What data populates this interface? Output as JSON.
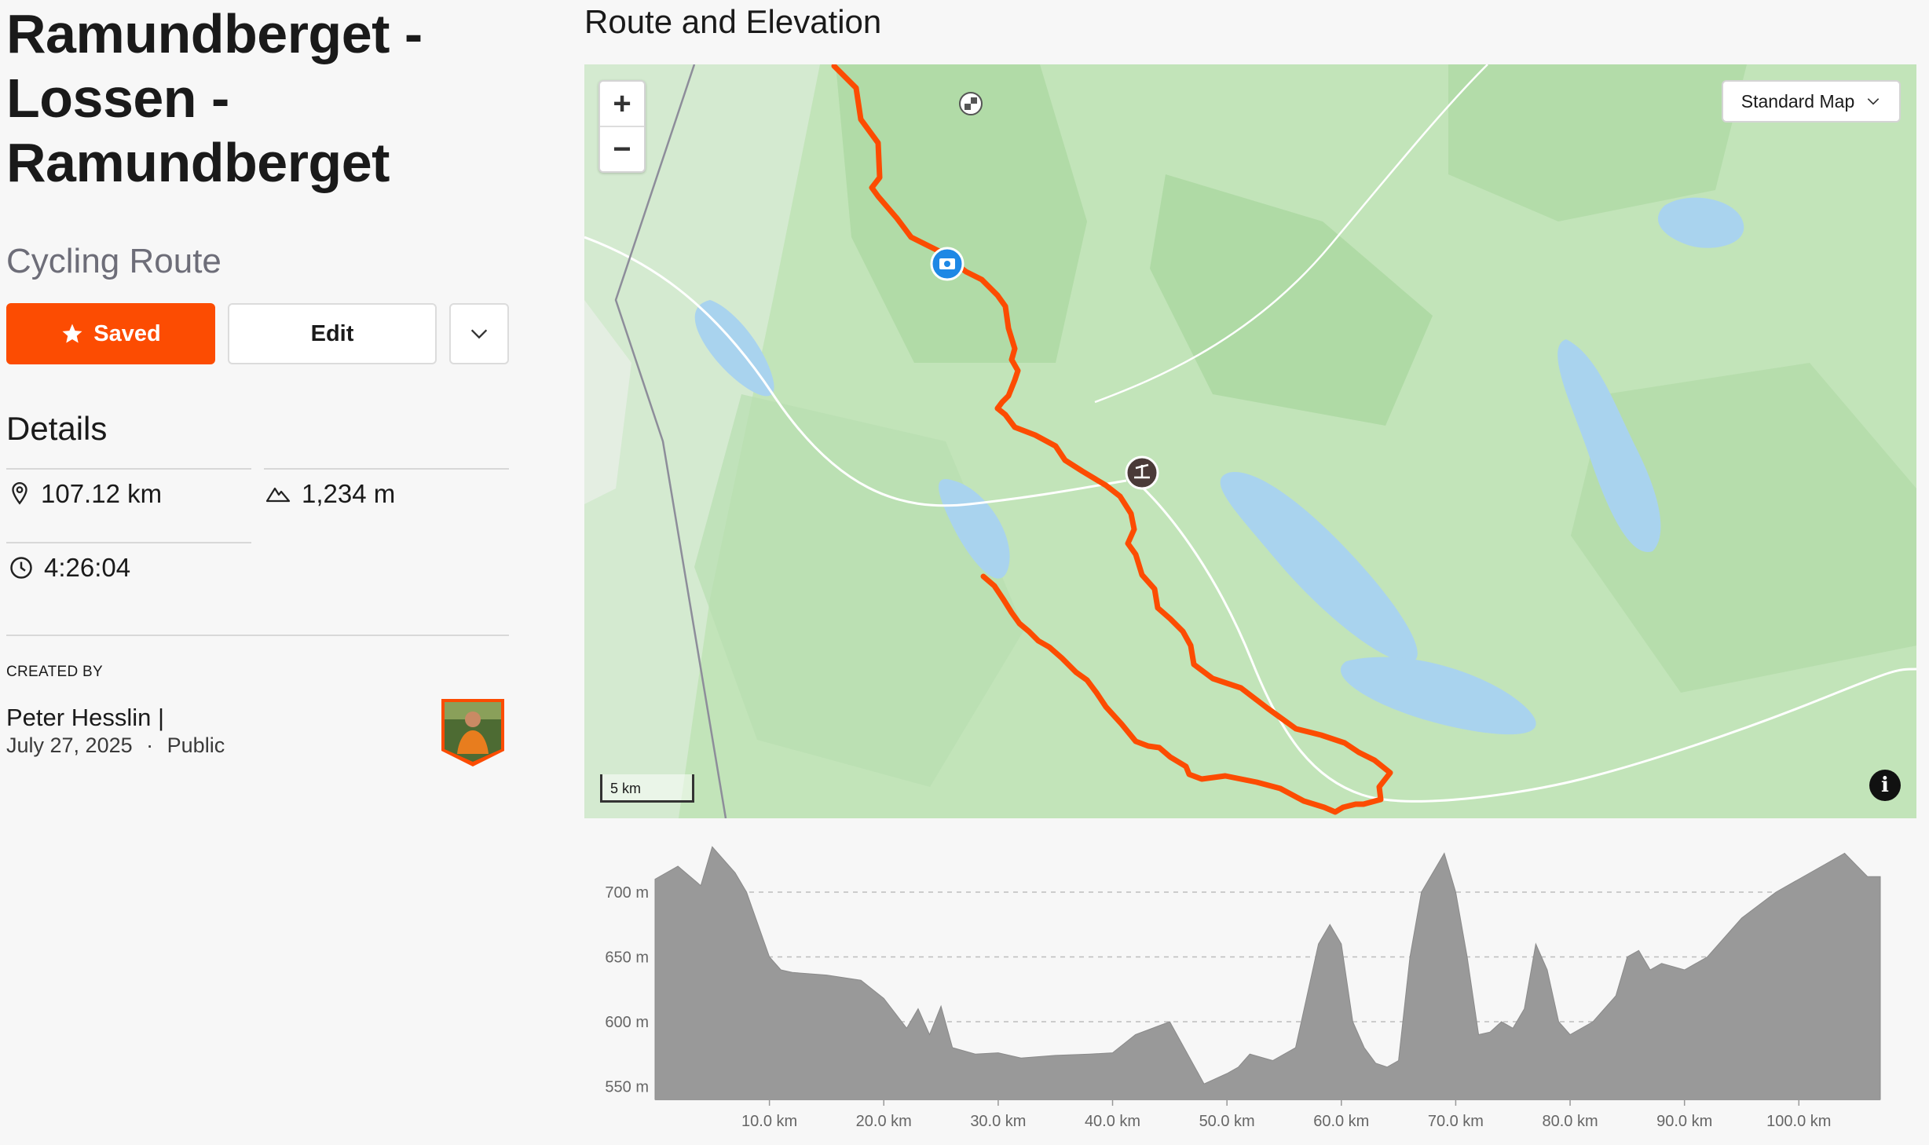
{
  "route": {
    "title_line1": "Ramundberget -",
    "title_line2": "Lossen -",
    "title_line3": "Ramundberget",
    "type": "Cycling Route"
  },
  "actions": {
    "saved_label": "Saved",
    "edit_label": "Edit"
  },
  "details": {
    "heading": "Details",
    "distance": "107.12 km",
    "elevation_gain": "1,234 m",
    "duration": "4:26:04"
  },
  "creator": {
    "label": "CREATED BY",
    "name": "Peter Hesslin |",
    "date": "July 27, 2025",
    "separator": "·",
    "visibility": "Public"
  },
  "map": {
    "section_title": "Route and Elevation",
    "map_type": "Standard Map",
    "zoom_in": "+",
    "zoom_out": "−",
    "scale_label": "5 km",
    "route_color": "#fc4c02"
  },
  "chart_data": {
    "type": "area",
    "title": "",
    "xlabel": "",
    "ylabel": "",
    "x_ticks": [
      "10.0 km",
      "20.0 km",
      "30.0 km",
      "40.0 km",
      "50.0 km",
      "60.0 km",
      "70.0 km",
      "80.0 km",
      "90.0 km",
      "100.0 km"
    ],
    "y_ticks": [
      "700 m",
      "650 m",
      "600 m",
      "550 m"
    ],
    "ylim": [
      540,
      740
    ],
    "xlim": [
      0,
      107.12
    ],
    "grid": "horizontal dashed",
    "series": [
      {
        "x": [
          0,
          2,
          4,
          5,
          7,
          8,
          10,
          11,
          12,
          15,
          18,
          20,
          22,
          23,
          24,
          25,
          26,
          28,
          30,
          32,
          35,
          38,
          40,
          42,
          45,
          48,
          50,
          51,
          52,
          54,
          56,
          57,
          58,
          59,
          60,
          61,
          62,
          63,
          64,
          65,
          66,
          67,
          68,
          69,
          70,
          71,
          72,
          73,
          74,
          75,
          76,
          77,
          78,
          79,
          80,
          81,
          82,
          83,
          84,
          85,
          86,
          87,
          88,
          90,
          92,
          95,
          98,
          100,
          102,
          104,
          106,
          107.12
        ],
        "y": [
          710,
          720,
          705,
          735,
          715,
          700,
          650,
          640,
          638,
          636,
          632,
          618,
          595,
          610,
          590,
          612,
          580,
          575,
          576,
          572,
          574,
          575,
          576,
          590,
          600,
          552,
          560,
          565,
          575,
          570,
          580,
          620,
          660,
          675,
          660,
          600,
          580,
          568,
          565,
          570,
          650,
          700,
          715,
          730,
          700,
          650,
          590,
          592,
          600,
          595,
          610,
          660,
          640,
          600,
          590,
          595,
          600,
          610,
          620,
          650,
          655,
          640,
          645,
          640,
          650,
          680,
          700,
          710,
          720,
          730,
          712,
          712
        ]
      }
    ],
    "color": "#999999"
  }
}
